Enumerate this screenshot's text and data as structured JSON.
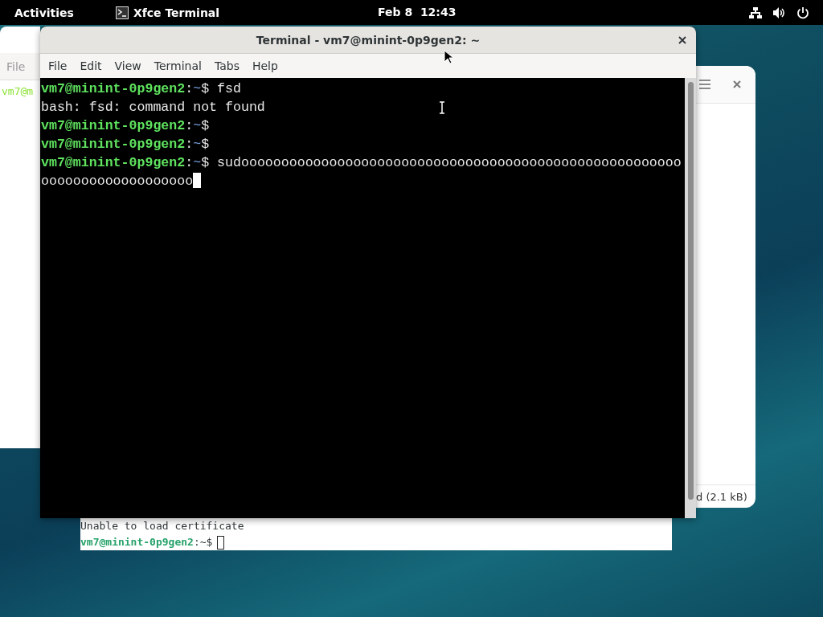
{
  "top_bar": {
    "activities": "Activities",
    "app_name": "Xfce Terminal",
    "clock": "Feb 8  12:43"
  },
  "left_window": {
    "menu_item": "File",
    "line_fragment": "vm7@m"
  },
  "right_window": {
    "status": "d (2.1 kB)"
  },
  "bottom_terminal": {
    "lines": [
      {
        "kind": "output",
        "text": "Unable to load certificate"
      },
      {
        "kind": "prompt",
        "user_host": "vm7@minint-0p9gen2",
        "separator": ":",
        "path": "~",
        "sigil": "$"
      }
    ]
  },
  "terminal_window": {
    "title": "Terminal - vm7@minint-0p9gen2: ~",
    "menu": [
      "File",
      "Edit",
      "View",
      "Terminal",
      "Tabs",
      "Help"
    ],
    "lines": [
      {
        "kind": "prompt",
        "user_host": "vm7@minint-0p9gen2",
        "separator": ":",
        "path": "~",
        "sigil": "$",
        "command": "fsd"
      },
      {
        "kind": "output",
        "text": "bash: fsd: command not found"
      },
      {
        "kind": "prompt",
        "user_host": "vm7@minint-0p9gen2",
        "separator": ":",
        "path": "~",
        "sigil": "$"
      },
      {
        "kind": "prompt",
        "user_host": "vm7@minint-0p9gen2",
        "separator": ":",
        "path": "~",
        "sigil": "$"
      },
      {
        "kind": "prompt",
        "user_host": "vm7@minint-0p9gen2",
        "separator": ":",
        "path": "~",
        "sigil": "$",
        "command": "sudoooooooooooooooooooooooooooooooooooooooooooooooooooooooooooooooooooooooooo"
      }
    ]
  }
}
